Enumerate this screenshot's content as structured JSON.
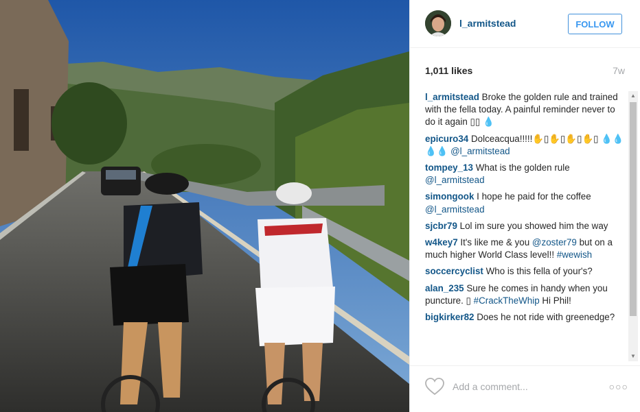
{
  "post": {
    "image_alt": "Two cyclists riding on a mountain road with a car ahead",
    "username": "l_armitstead",
    "follow_label": "FOLLOW",
    "likes": "1,011 likes",
    "age": "7w"
  },
  "comments": [
    {
      "author": "l_armitstead",
      "text": "Broke the golden rule and trained with the fella today. A painful reminder never to do it again ▯▯ 💧",
      "mention": "",
      "tag": ""
    },
    {
      "author": "epicuro34",
      "text": "Dolceacqua!!!!!✋▯✋▯✋▯✋▯ 💧💧💧💧",
      "mention": "@l_armitstead",
      "tag": ""
    },
    {
      "author": "tompey_13",
      "text": "What is the golden rule",
      "mention": "@l_armitstead",
      "tag": ""
    },
    {
      "author": "simongook",
      "text": "I hope he paid for the coffee",
      "mention": "@l_armitstead",
      "tag": ""
    },
    {
      "author": "sjcbr79",
      "text": "Lol im sure you showed him the way",
      "mention": "",
      "tag": ""
    },
    {
      "author": "w4key7",
      "text": "It's like me & you",
      "mention": "@zoster79",
      "text2": "but on a much higher World Class level!!",
      "tag": "#wewish"
    },
    {
      "author": "soccercyclist",
      "text": "Who is this fella of your's?",
      "mention": "",
      "tag": ""
    },
    {
      "author": "alan_235",
      "text": "Sure he comes in handy when you puncture. ▯",
      "mention": "",
      "tag": "#CrackTheWhip",
      "text2": "Hi Phil!"
    },
    {
      "author": "bigkirker82",
      "text": "Does he not ride with greenedge?",
      "mention": "",
      "tag": ""
    }
  ],
  "comment_box": {
    "placeholder": "Add a comment...",
    "more_label": "○○○"
  },
  "icons": {
    "heart": "heart-icon",
    "more": "more-options-icon",
    "scroll_up": "scroll-up-arrow-icon",
    "scroll_down": "scroll-down-arrow-icon"
  },
  "colors": {
    "link": "#125688",
    "follow": "#3897f0",
    "muted": "#a5a7aa"
  }
}
